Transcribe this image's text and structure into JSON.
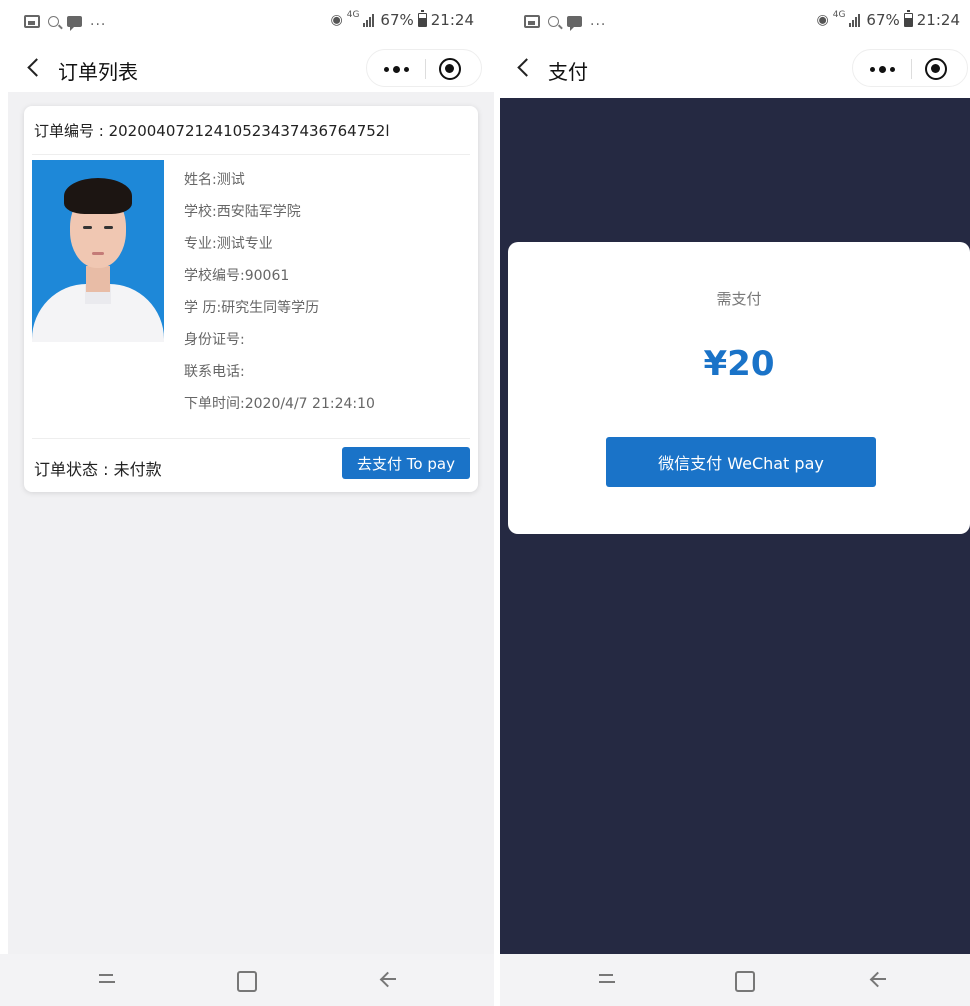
{
  "status_bar": {
    "left_dots": "...",
    "net_type": "4G",
    "battery": "67%",
    "time": "21:24"
  },
  "order_list_screen": {
    "nav_title": "订单列表",
    "order": {
      "order_no": "订单编号 : 20200407212410523437436764752l",
      "info": [
        "姓名:测试",
        "学校:西安陆军学院",
        "专业:测试专业",
        "学校编号:90061",
        "学 历:研究生同等学历",
        "身份证号:",
        "联系电话:",
        "下单时间:2020/4/7 21:24:10"
      ],
      "status": "订单状态 : 未付款",
      "pay_button": "去支付 To pay"
    }
  },
  "payment_screen": {
    "nav_title": "支付",
    "need_pay_label": "需支付",
    "amount": "¥20",
    "wechat_pay_button": "微信支付 WeChat pay"
  },
  "colors": {
    "primary": "#1a73c8",
    "overlay": "#252942",
    "list_background": "#f1f1f3"
  }
}
